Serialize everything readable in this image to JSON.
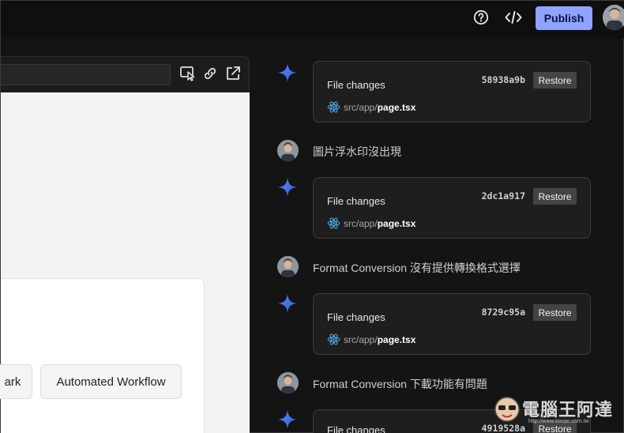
{
  "topbar": {
    "publish_label": "Publish",
    "icons": [
      "help-circle-icon",
      "code-icon",
      "avatar"
    ]
  },
  "preview": {
    "url_value": "",
    "toolbar_icons": [
      "select-element-icon",
      "link-icon",
      "external-link-icon"
    ],
    "chips": [
      "ark",
      "Automated Workflow"
    ]
  },
  "chat": {
    "file_cards": [
      {
        "title": "File changes",
        "hash": "58938a9b",
        "restore_label": "Restore",
        "path_dir": "src/app/",
        "path_file": "page.tsx"
      },
      {
        "title": "File changes",
        "hash": "2dc1a917",
        "restore_label": "Restore",
        "path_dir": "src/app/",
        "path_file": "page.tsx"
      },
      {
        "title": "File changes",
        "hash": "8729c95a",
        "restore_label": "Restore",
        "path_dir": "src/app/",
        "path_file": "page.tsx"
      },
      {
        "title": "File changes",
        "hash": "4919528a",
        "restore_label": "Restore"
      }
    ],
    "user_messages": [
      "圖片浮水印沒出現",
      "Format Conversion 沒有提供轉換格式選擇",
      "Format Conversion 下載功能有問題"
    ]
  },
  "watermark": {
    "text": "電腦王阿達",
    "url": "http://www.kocpc.com.tw"
  },
  "colors": {
    "background": "#141414",
    "publish": "#8fa3ff",
    "card": "#1e1e1e",
    "react": "#4fa3d9"
  }
}
